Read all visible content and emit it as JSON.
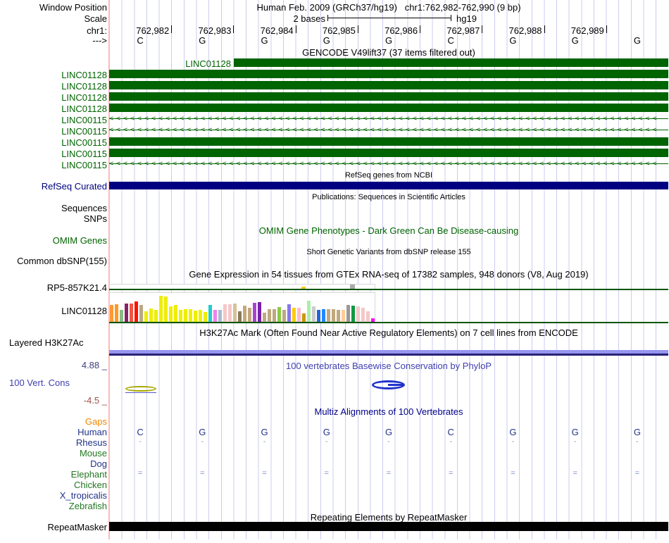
{
  "header": {
    "window_position_label": "Window Position",
    "title": "Human Feb. 2009 (GRCh37/hg19)   chr1:762,982-762,990 (9 bp)"
  },
  "scale": {
    "label": "Scale",
    "amount": "2 bases",
    "assembly": "hg19"
  },
  "ruler": {
    "chrom_label": "chr1:",
    "strand_label": "--->",
    "coordinates": [
      "762,982",
      "762,983",
      "762,984",
      "762,985",
      "762,986",
      "762,987",
      "762,988",
      "762,989"
    ]
  },
  "sequence": {
    "bases": [
      "C",
      "G",
      "G",
      "G",
      "G",
      "C",
      "G",
      "G",
      "G"
    ]
  },
  "gencode": {
    "header": "GENCODE V49lift37 (37 items filtered out)",
    "color": "#006400",
    "rows": [
      {
        "label": "LINC01128",
        "style": "inline"
      },
      {
        "label": "LINC01128",
        "style": "solid"
      },
      {
        "label": "LINC01128",
        "style": "solid"
      },
      {
        "label": "LINC01128",
        "style": "solid"
      },
      {
        "label": "LINC01128",
        "style": "solid"
      },
      {
        "label": "LINC00115",
        "style": "arrows"
      },
      {
        "label": "LINC00115",
        "style": "arrows"
      },
      {
        "label": "LINC00115",
        "style": "solid"
      },
      {
        "label": "LINC00115",
        "style": "solid"
      },
      {
        "label": "LINC00115",
        "style": "arrows"
      }
    ]
  },
  "refseq": {
    "header": "RefSeq genes from NCBI",
    "label": "RefSeq Curated",
    "color": "#000080"
  },
  "publications": {
    "header": "Publications: Sequences in Scientific Articles",
    "label": "Sequences"
  },
  "snps": {
    "label": "SNPs"
  },
  "omim": {
    "header": "OMIM Gene Phenotypes - Dark Green Can Be Disease-causing",
    "label": "OMIM Genes",
    "color": "#006400"
  },
  "dbsnp": {
    "header": "Short Genetic Variants from dbSNP release 155",
    "label": "Common dbSNP(155)"
  },
  "gtex": {
    "header": "Gene Expression in 54 tissues from GTEx RNA-seq of 17382 samples, 948 donors (V8, Aug 2019)",
    "row1_label": "RP5-857K21.4",
    "row2_label": "LINC01128",
    "bars": [
      {
        "c": "#ff9933",
        "h": 24
      },
      {
        "c": "#ff9922",
        "h": 25
      },
      {
        "c": "#88bb88",
        "h": 17
      },
      {
        "c": "#882266",
        "h": 26
      },
      {
        "c": "#ee5544",
        "h": 26
      },
      {
        "c": "#ff1100",
        "h": 29
      },
      {
        "c": "#bba584",
        "h": 24
      },
      {
        "c": "#eeee00",
        "h": 15
      },
      {
        "c": "#eeee00",
        "h": 19
      },
      {
        "c": "#eeee00",
        "h": 17
      },
      {
        "c": "#eeee00",
        "h": 37
      },
      {
        "c": "#eeee00",
        "h": 36
      },
      {
        "c": "#eeee00",
        "h": 22
      },
      {
        "c": "#eeee00",
        "h": 24
      },
      {
        "c": "#eeee00",
        "h": 17
      },
      {
        "c": "#eeee00",
        "h": 18
      },
      {
        "c": "#eeee00",
        "h": 18
      },
      {
        "c": "#eeee00",
        "h": 16
      },
      {
        "c": "#eeee00",
        "h": 17
      },
      {
        "c": "#eeee00",
        "h": 14
      },
      {
        "c": "#22cccc",
        "h": 24
      },
      {
        "c": "#ee82ee",
        "h": 17
      },
      {
        "c": "#a8bcd0",
        "h": 17
      },
      {
        "c": "#f4c8c8",
        "h": 25
      },
      {
        "c": "#f4c8c8",
        "h": 25
      },
      {
        "c": "#d8c098",
        "h": 26
      },
      {
        "c": "#8a7a58",
        "h": 15
      },
      {
        "c": "#c8a878",
        "h": 23
      },
      {
        "c": "#c0a880",
        "h": 20
      },
      {
        "c": "#aa44cc",
        "h": 27
      },
      {
        "c": "#7722aa",
        "h": 28
      },
      {
        "c": "#c0a880",
        "h": 13
      },
      {
        "c": "#c0a880",
        "h": 18
      },
      {
        "c": "#c0a880",
        "h": 18
      },
      {
        "c": "#88cc44",
        "h": 21
      },
      {
        "c": "#c0a880",
        "h": 17
      },
      {
        "c": "#8877ee",
        "h": 25
      },
      {
        "c": "#ffcc00",
        "h": 20
      },
      {
        "c": "#ffbbcc",
        "h": 20
      },
      {
        "c": "#cc9900",
        "h": 12
      },
      {
        "c": "#aaeeaa",
        "h": 30
      },
      {
        "c": "#cccccc",
        "h": 22
      },
      {
        "c": "#2266dd",
        "h": 17
      },
      {
        "c": "#2288ff",
        "h": 18
      },
      {
        "c": "#c0a880",
        "h": 18
      },
      {
        "c": "#c0a880",
        "h": 18
      },
      {
        "c": "#c0a880",
        "h": 17
      },
      {
        "c": "#ffcc99",
        "h": 17
      },
      {
        "c": "#999999",
        "h": 24
      },
      {
        "c": "#119944",
        "h": 23
      },
      {
        "c": "#f4c8c8",
        "h": 22
      },
      {
        "c": "#f4c8c8",
        "h": 20
      },
      {
        "c": "#f4c8c8",
        "h": 15
      },
      {
        "c": "#ff00ff",
        "h": 5
      }
    ]
  },
  "h3k27ac": {
    "header": "H3K27Ac Mark (Often Found Near Active Regulatory Elements) on 7 cell lines from ENCODE",
    "label": "Layered H3K27Ac",
    "color_top": "#9595ef",
    "color_bottom": "#2a2178"
  },
  "conservation": {
    "header": "100 vertebrates Basewise Conservation by PhyloP",
    "label": "100 Vert. Cons",
    "max": "4.88 _",
    "min": "-4.5 _"
  },
  "multiz": {
    "header": "Multiz Alignments of 100 Vertebrates",
    "gaps_label": "Gaps",
    "species": [
      {
        "name": "Gaps",
        "color": "#ee8800",
        "content": "none"
      },
      {
        "name": "Human",
        "color": "#223388",
        "content": "bases"
      },
      {
        "name": "Rhesus",
        "color": "#223388",
        "content": "dashes"
      },
      {
        "name": "Mouse",
        "color": "#227722",
        "content": "none"
      },
      {
        "name": "Dog",
        "color": "#223388",
        "content": "none"
      },
      {
        "name": "Elephant",
        "color": "#227722",
        "content": "equals"
      },
      {
        "name": "Chicken",
        "color": "#227722",
        "content": "none"
      },
      {
        "name": "X_tropicalis",
        "color": "#223388",
        "content": "none"
      },
      {
        "name": "Zebrafish",
        "color": "#227722",
        "content": "none"
      }
    ]
  },
  "repeatmasker": {
    "header": "Repeating Elements by RepeatMasker",
    "label": "RepeatMasker"
  }
}
